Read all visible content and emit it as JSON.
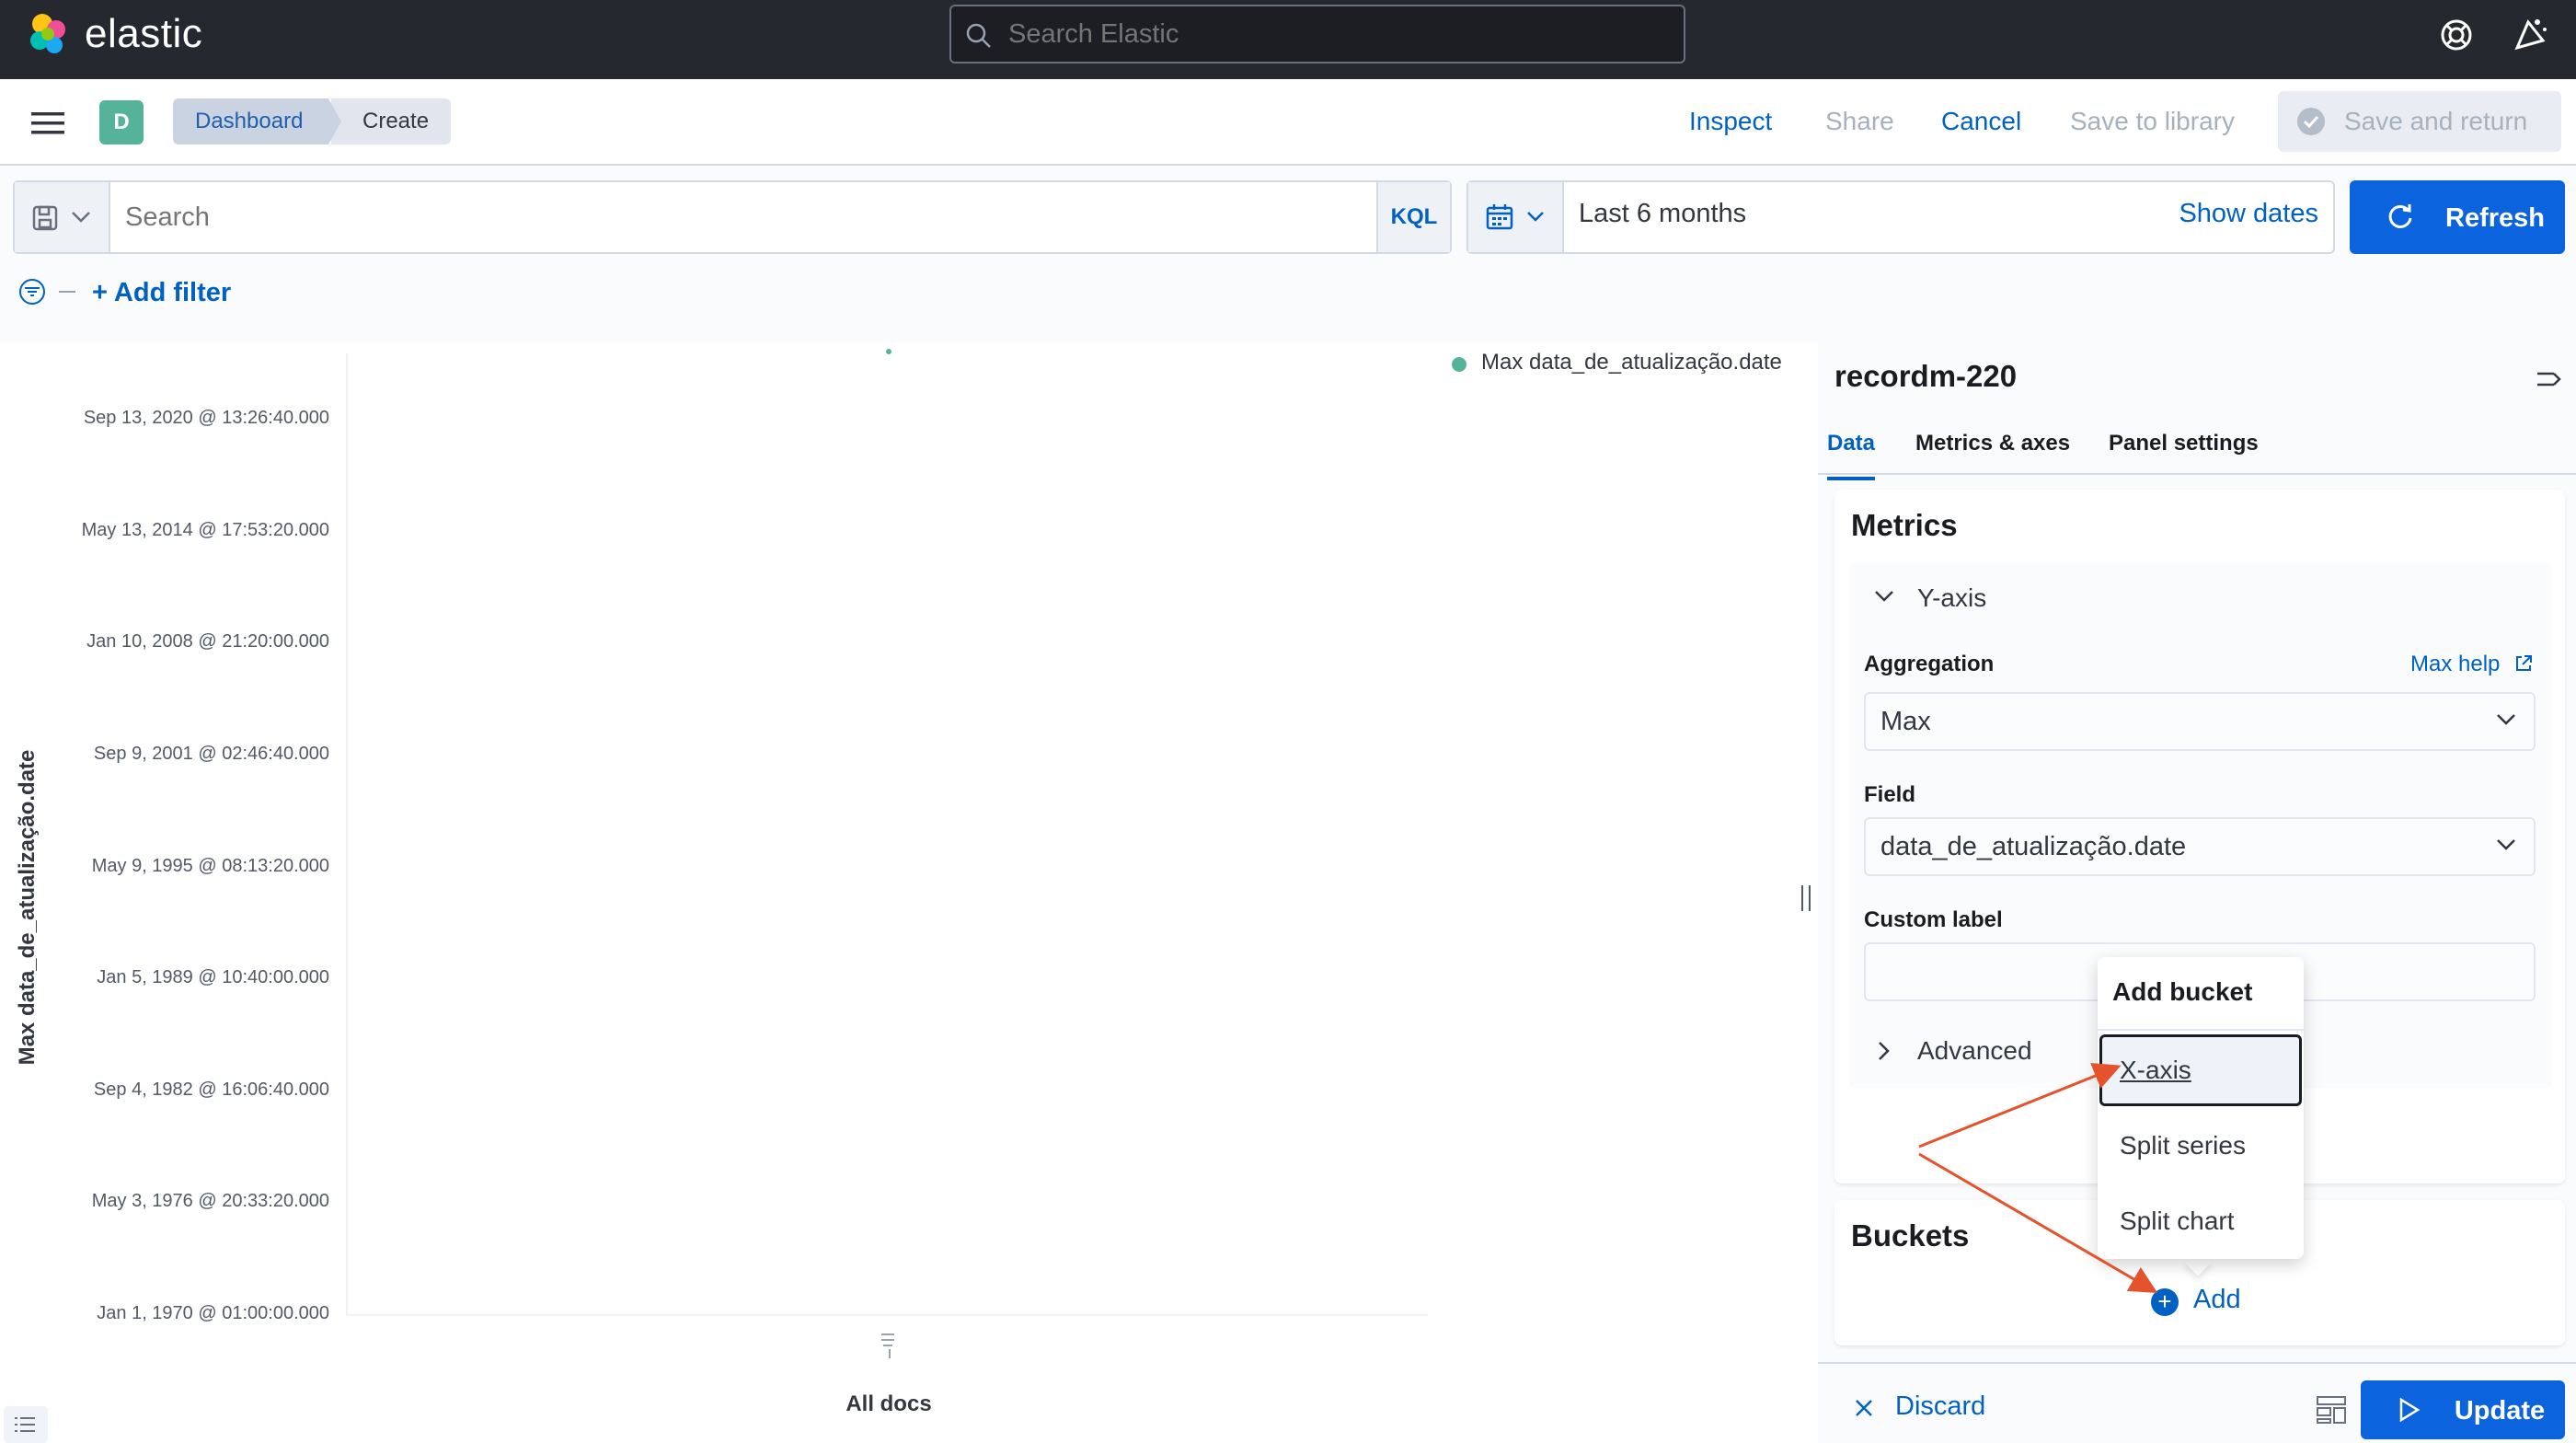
{
  "header": {
    "logo_text": "elastic",
    "search_placeholder": "Search Elastic",
    "avatar_letter": "D"
  },
  "breadcrumbs": [
    "Dashboard",
    "Create"
  ],
  "top_nav": {
    "inspect": "Inspect",
    "share": "Share",
    "cancel": "Cancel",
    "save_to_library": "Save to library",
    "save_and_return": "Save and return"
  },
  "query_bar": {
    "placeholder": "Search",
    "language": "KQL",
    "time_range": "Last 6 months",
    "show_dates": "Show dates",
    "refresh": "Refresh",
    "add_filter": "+ Add filter"
  },
  "chart_data": {
    "type": "scatter",
    "title": "",
    "ylabel": "Max data_de_atualização.date",
    "xlabel": "",
    "categories": [
      "All docs"
    ],
    "yticks": [
      "Sep 13, 2020 @ 13:26:40.000",
      "May 13, 2014 @ 17:53:20.000",
      "Jan 10, 2008 @ 21:20:00.000",
      "Sep 9, 2001 @ 02:46:40.000",
      "May 9, 1995 @ 08:13:20.000",
      "Jan 5, 1989 @ 10:40:00.000",
      "Sep 4, 1982 @ 16:06:40.000",
      "May 3, 1976 @ 20:33:20.000",
      "Jan 1, 1970 @ 01:00:00.000"
    ],
    "ylim": [
      0,
      8.47
    ],
    "series": [
      {
        "name": "Max data_de_atualização.date",
        "color": "#54b399",
        "points": [
          {
            "x": "All docs",
            "y": 8.47
          }
        ]
      }
    ],
    "legend_position": "top-right",
    "grid": false
  },
  "sidebar": {
    "title": "recordm-220",
    "tabs": [
      "Data",
      "Metrics & axes",
      "Panel settings"
    ],
    "metrics_heading": "Metrics",
    "yaxis_label": "Y-axis",
    "aggregation_label": "Aggregation",
    "max_help": "Max help",
    "aggregation_value": "Max",
    "field_label": "Field",
    "field_value": "data_de_atualização.date",
    "custom_label": "Custom label",
    "custom_label_value": "",
    "advanced": "Advanced",
    "buckets_heading": "Buckets",
    "add": "Add",
    "discard": "Discard",
    "update": "Update"
  },
  "popover": {
    "title": "Add bucket",
    "items": [
      "X-axis",
      "Split series",
      "Split chart"
    ]
  },
  "colors": {
    "accent": "#0b64dd",
    "link": "#0061c2",
    "series": "#54b399",
    "annotation_arrow": "#e5532d"
  }
}
